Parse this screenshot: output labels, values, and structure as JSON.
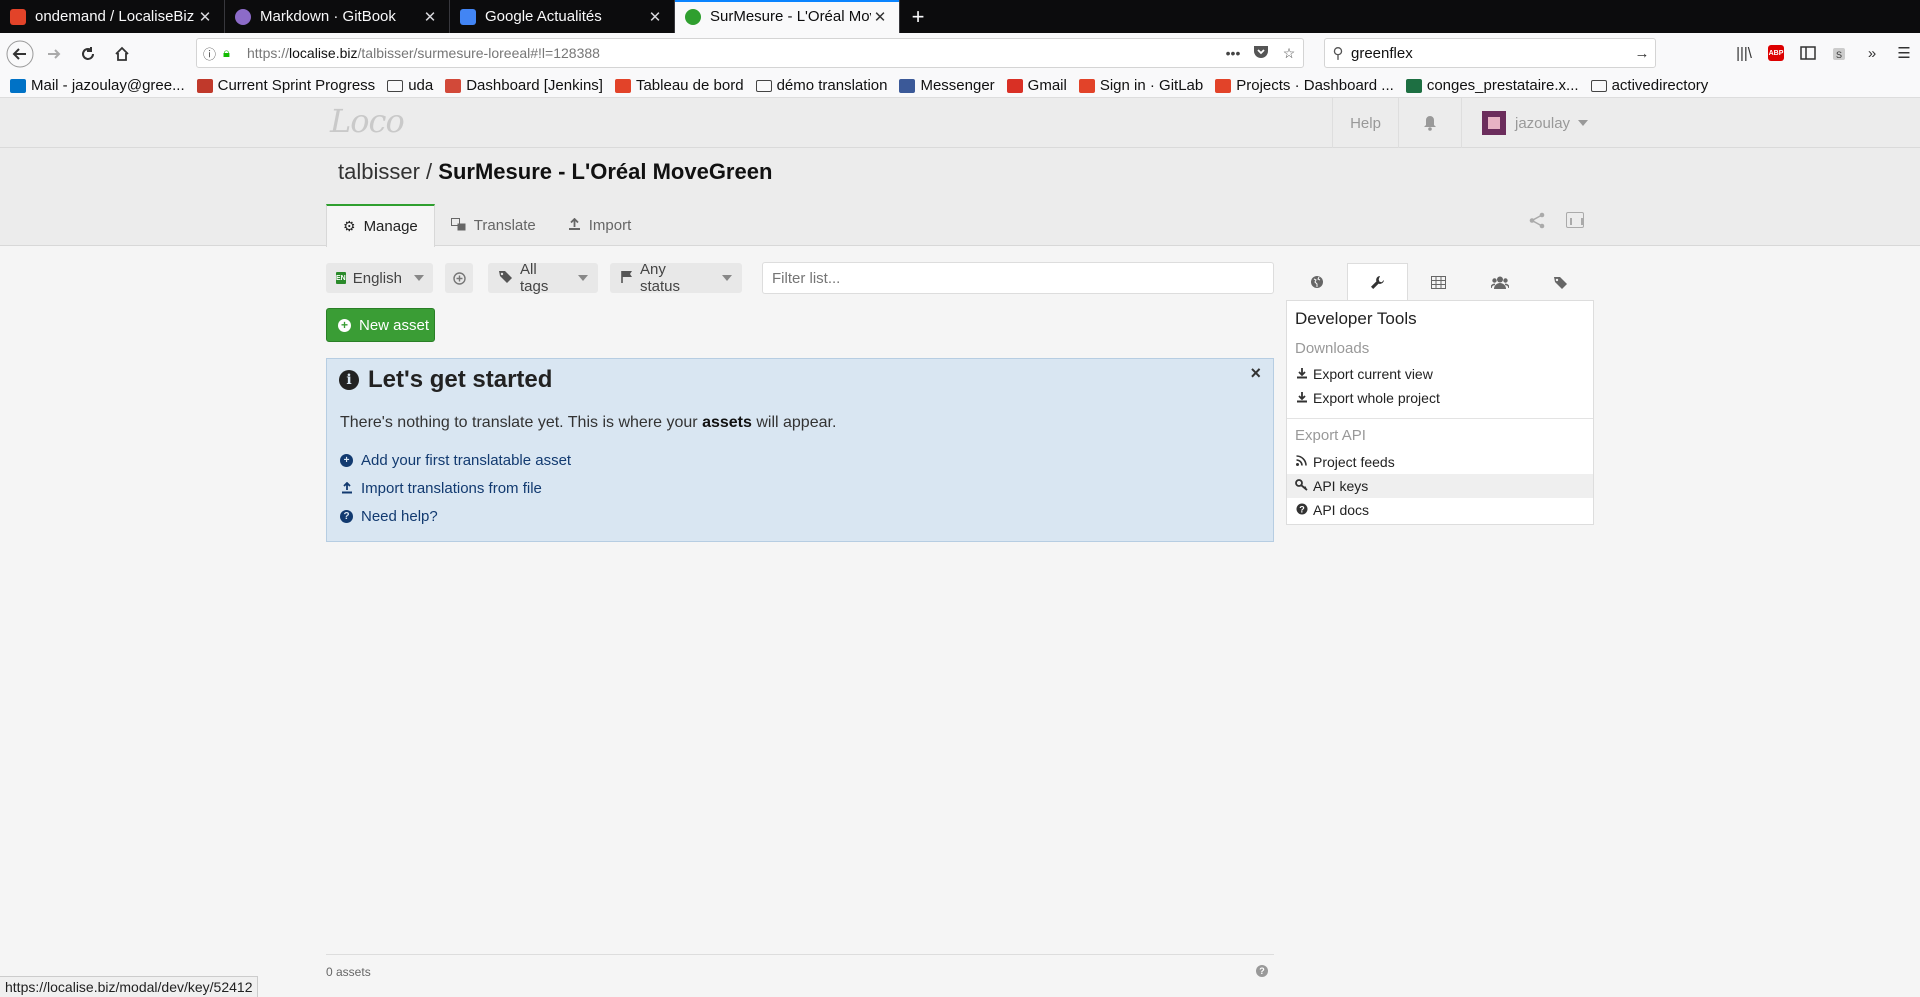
{
  "browser": {
    "tabs": [
      {
        "title": "ondemand / LocaliseBiz",
        "favicon_color": "#e24329"
      },
      {
        "title": "Markdown · GitBook",
        "favicon_color": "#8c6bc8"
      },
      {
        "title": "Google Actualités",
        "favicon_color": "#4285f4"
      },
      {
        "title": "SurMesure - L'Oréal Mov",
        "favicon_color": "#2f9f2f"
      }
    ],
    "url_host": "localise.biz",
    "url_prefix": "https://",
    "url_path": "/talbisser/surmesure-loreeal#!l=128388",
    "search_query": "greenflex",
    "bookmarks": [
      {
        "label": "Mail - jazoulay@gree...",
        "color": "#0072c6"
      },
      {
        "label": "Current Sprint Progress",
        "color": "#c0392b"
      },
      {
        "label": "uda",
        "folder": true
      },
      {
        "label": "Dashboard [Jenkins]",
        "color": "#d24939"
      },
      {
        "label": "Tableau de bord",
        "color": "#e24329"
      },
      {
        "label": "démo translation",
        "folder": true
      },
      {
        "label": "Messenger",
        "color": "#3b5998"
      },
      {
        "label": "Gmail",
        "color": "#d93025"
      },
      {
        "label": "Sign in · GitLab",
        "color": "#e24329"
      },
      {
        "label": "Projects · Dashboard ...",
        "color": "#e24329"
      },
      {
        "label": "conges_prestataire.x...",
        "color": "#1d6f42"
      },
      {
        "label": "activedirectory",
        "folder": true
      }
    ],
    "status_url": "https://localise.biz/modal/dev/key/52412"
  },
  "topnav": {
    "logo": "Loco",
    "help": "Help",
    "username": "jazoulay"
  },
  "header": {
    "owner": "talbisser /",
    "project": "SurMesure - L'Oréal MoveGreen",
    "tabs": [
      "Manage",
      "Translate",
      "Import"
    ]
  },
  "filters": {
    "language_code": "EN",
    "language": "English",
    "tags": "All tags",
    "status": "Any status",
    "search_placeholder": "Filter list..."
  },
  "new_asset_label": "New asset",
  "callout": {
    "title": "Let's get started",
    "text_before": "There's nothing to translate yet. This is where your",
    "text_bold": "assets",
    "text_after": "will appear.",
    "links": [
      "Add your first translatable asset",
      "Import translations from file",
      "Need help?"
    ]
  },
  "panel": {
    "title": "Developer Tools",
    "downloads_heading": "Downloads",
    "downloads": [
      "Export current view",
      "Export whole project"
    ],
    "api_heading": "Export API",
    "api_items": [
      "Project feeds",
      "API keys",
      "API docs"
    ]
  },
  "footer": {
    "asset_count": "0 assets"
  }
}
